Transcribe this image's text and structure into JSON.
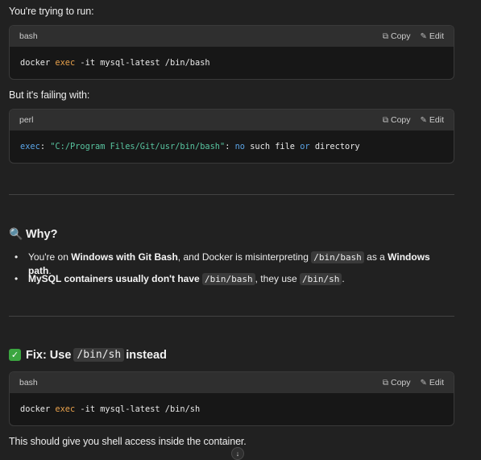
{
  "intro": "You're trying to run:",
  "code1": {
    "lang": "bash",
    "copy": "Copy",
    "edit": "Edit",
    "tokens": [
      {
        "t": "docker ",
        "c": ""
      },
      {
        "t": "exec",
        "c": "kw-orange"
      },
      {
        "t": " -it mysql-latest /bin/bash",
        "c": ""
      }
    ]
  },
  "failing": "But it's failing with:",
  "code2": {
    "lang": "perl",
    "copy": "Copy",
    "edit": "Edit",
    "tokens": [
      {
        "t": "exec",
        "c": "kw-blue"
      },
      {
        "t": ": ",
        "c": ""
      },
      {
        "t": "\"C:/Program Files/Git/usr/bin/bash\"",
        "c": "str-green"
      },
      {
        "t": ": ",
        "c": ""
      },
      {
        "t": "no",
        "c": "kw-blue"
      },
      {
        "t": " such file ",
        "c": ""
      },
      {
        "t": "or",
        "c": "kw-blue"
      },
      {
        "t": " directory",
        "c": ""
      }
    ]
  },
  "why": {
    "icon": "magnifier-icon",
    "title": "Why?"
  },
  "bullet1": {
    "a": "You're on ",
    "b": "Windows with Git Bash",
    "c": ", and Docker is misinterpreting ",
    "code": "/bin/bash",
    "d": " as a ",
    "e": "Windows path",
    "f": "."
  },
  "bullet2": {
    "b": "MySQL containers usually don't have ",
    "code1": "/bin/bash",
    "c": ", they use ",
    "code2": "/bin/sh",
    "d": "."
  },
  "fix": {
    "icon": "check-icon",
    "prefix": "Fix: Use ",
    "code": "/bin/sh",
    "suffix": " instead"
  },
  "code3": {
    "lang": "bash",
    "copy": "Copy",
    "edit": "Edit",
    "tokens": [
      {
        "t": "docker ",
        "c": ""
      },
      {
        "t": "exec",
        "c": "kw-orange"
      },
      {
        "t": " -it mysql-latest /bin/sh",
        "c": ""
      }
    ]
  },
  "outro": "This should give you shell access inside the container.",
  "colors": {
    "background": "#212121",
    "code_bg": "#171717",
    "header_bg": "#2f2f2f",
    "keyword_orange": "#e6a04b",
    "keyword_blue": "#5aa4e6",
    "string_green": "#58c4a0",
    "check_green": "#3ba640"
  }
}
